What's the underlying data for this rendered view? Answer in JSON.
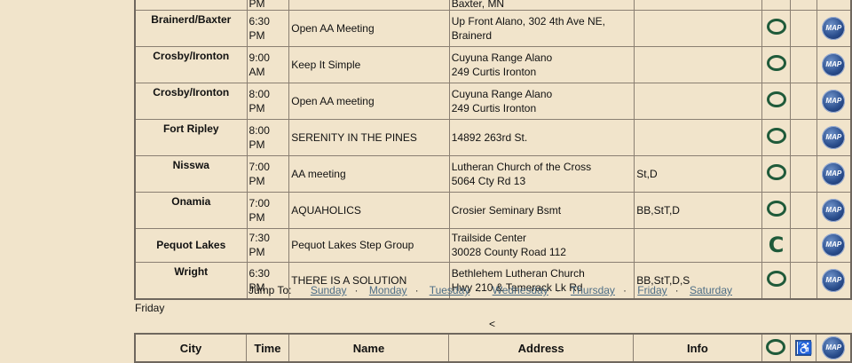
{
  "partial_row": {
    "address": "Baxter, MN",
    "time": "PM"
  },
  "meetings": [
    {
      "city": "Brainerd/Baxter",
      "time": [
        "6:30",
        "PM"
      ],
      "name": "Open AA  Meeting",
      "address": [
        "Up Front Alano, 302 4th Ave NE,",
        "Brainerd"
      ],
      "info": "",
      "type": "open"
    },
    {
      "city": "Crosby/Ironton",
      "time": [
        "9:00",
        "AM"
      ],
      "name": "Keep It Simple",
      "address": [
        "Cuyuna Range Alano",
        "249 Curtis Ironton"
      ],
      "info": "",
      "type": "open"
    },
    {
      "city": "Crosby/Ironton",
      "time": [
        "8:00",
        "PM"
      ],
      "name": "Open AA meeting",
      "address": [
        "Cuyuna Range Alano",
        "249 Curtis Ironton"
      ],
      "info": "",
      "type": "open"
    },
    {
      "city": "Fort Ripley",
      "time": [
        "8:00",
        "PM"
      ],
      "name": "SERENITY IN THE PINES",
      "address": [
        "14892 263rd St.",
        ""
      ],
      "info": "",
      "type": "open"
    },
    {
      "city": "Nisswa",
      "time": [
        "7:00",
        "PM"
      ],
      "name": "AA meeting",
      "address": [
        "Lutheran Church of the Cross",
        "5064 Cty Rd 13"
      ],
      "info": "St,D",
      "type": "open"
    },
    {
      "city": "Onamia",
      "time": [
        "7:00",
        "PM"
      ],
      "name": "AQUAHOLICS",
      "address": [
        "Crosier Seminary Bsmt",
        ""
      ],
      "info": "BB,StT,D",
      "type": "open"
    },
    {
      "city": "Pequot Lakes",
      "time": [
        "7:30",
        "PM"
      ],
      "name": "Pequot Lakes Step Group",
      "address": [
        "Trailside Center",
        "30028 County Road 112"
      ],
      "info": "",
      "type": "closed"
    },
    {
      "city": "Wright",
      "time": [
        "6:30",
        "PM"
      ],
      "name": "THERE IS A SOLUTION",
      "address": [
        "Bethlehem Lutheran Church",
        "Hwy 210 & Tamerack Lk Rd"
      ],
      "info": "BB,StT,D,S",
      "type": "open"
    }
  ],
  "icons": {
    "open": "open-meeting-icon",
    "closed": "closed-meeting-icon",
    "map": "map-icon",
    "map_text": "MAP",
    "closed_text": "C",
    "wheelchair": "wheelchair-icon"
  },
  "jump": {
    "label": "Jump To:",
    "days": [
      "Sunday",
      "Monday",
      "Tuesday",
      "Wednesday",
      "Thursday",
      "Friday",
      "Saturday"
    ],
    "separator": "·"
  },
  "section_day": "Friday",
  "less_than": "<",
  "headers": {
    "city": "City",
    "time": "Time",
    "name": "Name",
    "address": "Address",
    "info": "Info"
  },
  "colors": {
    "background": "#f1e4cb",
    "icon_green": "#1f5a3a",
    "link": "#4e6e86",
    "map_blue": "#2b4f8e"
  }
}
